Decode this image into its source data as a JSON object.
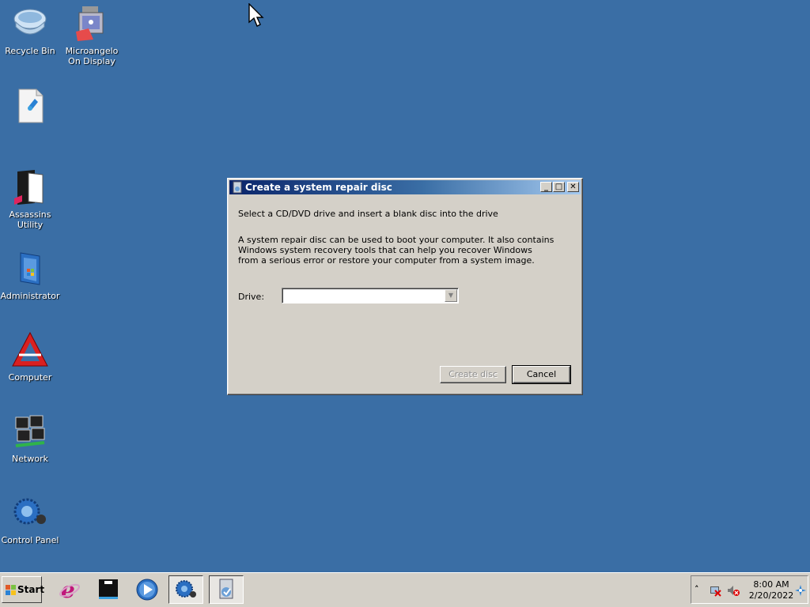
{
  "desktop": {
    "icons": [
      {
        "label": "Recycle Bin"
      },
      {
        "label": "Microangelo On Display"
      },
      {
        "label": ""
      },
      {
        "label": "Assassins Utility"
      },
      {
        "label": "Administrator"
      },
      {
        "label": "Computer"
      },
      {
        "label": "Network"
      },
      {
        "label": "Control Panel"
      }
    ]
  },
  "dialog": {
    "title": "Create a system repair disc",
    "heading": "Select a CD/DVD drive and insert a blank disc into the drive",
    "description": "A system repair disc can be used to boot your computer. It also contains Windows system recovery tools that can help you recover Windows from a serious error or restore your computer from a system image.",
    "drive_label": "Drive:",
    "drive_value": "",
    "create_button": "Create disc",
    "cancel_button": "Cancel",
    "minimize_glyph": "_",
    "maximize_glyph": "□",
    "close_glyph": "✕"
  },
  "taskbar": {
    "start_label": "Start",
    "apps": [
      {
        "icon": "internet-explorer-icon"
      },
      {
        "icon": "terminal-icon"
      },
      {
        "icon": "media-player-icon"
      },
      {
        "icon": "control-panel-icon"
      },
      {
        "icon": "repair-disc-icon"
      }
    ],
    "tray": {
      "expand_glyph": "˄",
      "time": "8:00 AM",
      "date": "2/20/2022"
    }
  },
  "colors": {
    "desktop": "#3a6ea5",
    "face": "#d4d0c8",
    "title_start": "#0a246a",
    "title_end": "#a6caf0"
  }
}
